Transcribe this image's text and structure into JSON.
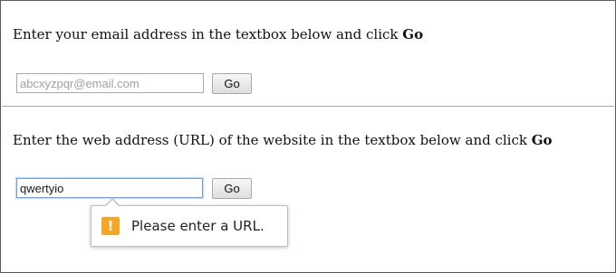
{
  "email_section": {
    "instruction": "Enter your email address in the textbox below and click ",
    "instruction_bold": "Go",
    "input_placeholder": "abcxyzpqr@email.com",
    "input_value": "",
    "button_label": "Go"
  },
  "url_section": {
    "instruction": "Enter the web address (URL) of the website in the textbox below and click ",
    "instruction_bold": "Go",
    "input_value": "qwertyio",
    "button_label": "Go"
  },
  "validation_tooltip": {
    "icon": "warning-icon",
    "icon_glyph": "!",
    "message": "Please enter a URL.",
    "icon_color": "#f5a623"
  },
  "colors": {
    "focus_border": "#6f9fe6",
    "divider": "#a8a8a8"
  }
}
